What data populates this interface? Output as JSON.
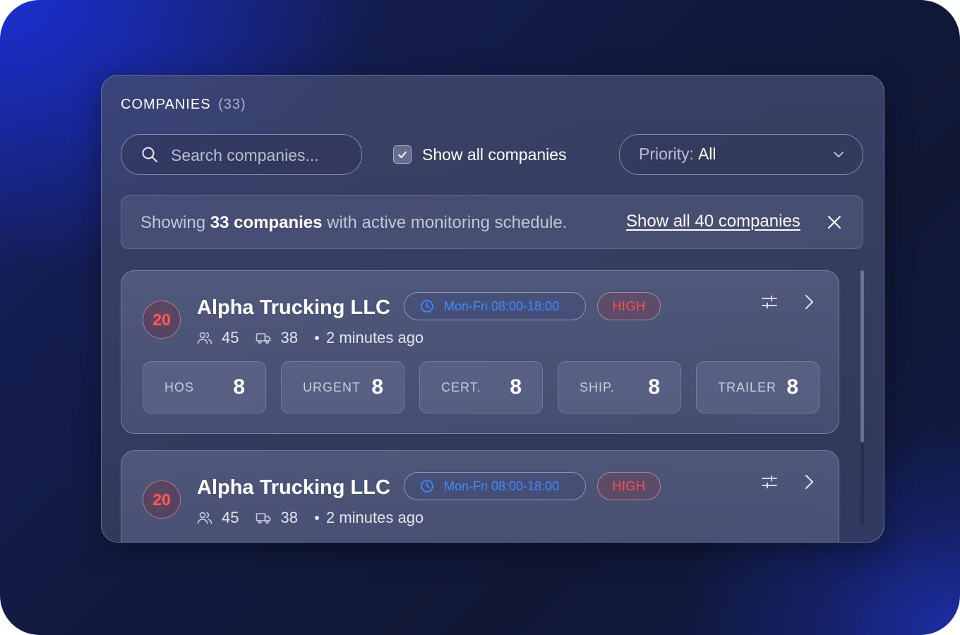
{
  "panel": {
    "title": "COMPANIES",
    "count": "(33)"
  },
  "search": {
    "placeholder": "Search companies..."
  },
  "filter": {
    "show_all_label": "Show all companies",
    "show_all_checked": true,
    "priority_label": "Priority:",
    "priority_value": "All"
  },
  "banner": {
    "text_prefix": "Showing",
    "text_bold": "33 companies",
    "text_suffix": "with active monitoring schedule.",
    "link_label": "Show all 40 companies"
  },
  "companies": [
    {
      "score": "20",
      "name": "Alpha Trucking LLC",
      "schedule": "Mon-Fri 08:00-18:00",
      "priority": "HIGH",
      "drivers": "45",
      "vehicles": "38",
      "updated": "2 minutes ago",
      "stats": [
        {
          "label": "HOS",
          "value": "8"
        },
        {
          "label": "URGENT",
          "value": "8"
        },
        {
          "label": "CERT.",
          "value": "8"
        },
        {
          "label": "SHIP.",
          "value": "8"
        },
        {
          "label": "TRAILER",
          "value": "8"
        }
      ]
    },
    {
      "score": "20",
      "name": "Alpha Trucking LLC",
      "schedule": "Mon-Fri 08:00-18:00",
      "priority": "HIGH",
      "drivers": "45",
      "vehicles": "38",
      "updated": "2 minutes ago"
    }
  ],
  "colors": {
    "accent_blue": "#3d8bff",
    "priority_high": "#ff4d4d",
    "score_red": "#ff5a55"
  },
  "icons": {
    "search": "search-icon",
    "check": "check-icon",
    "chevron": "chevron-down-icon",
    "close": "close-icon",
    "clock": "clock-icon",
    "users": "users-icon",
    "truck": "truck-icon",
    "tune": "sliders-icon",
    "goto": "chevron-right-icon"
  }
}
